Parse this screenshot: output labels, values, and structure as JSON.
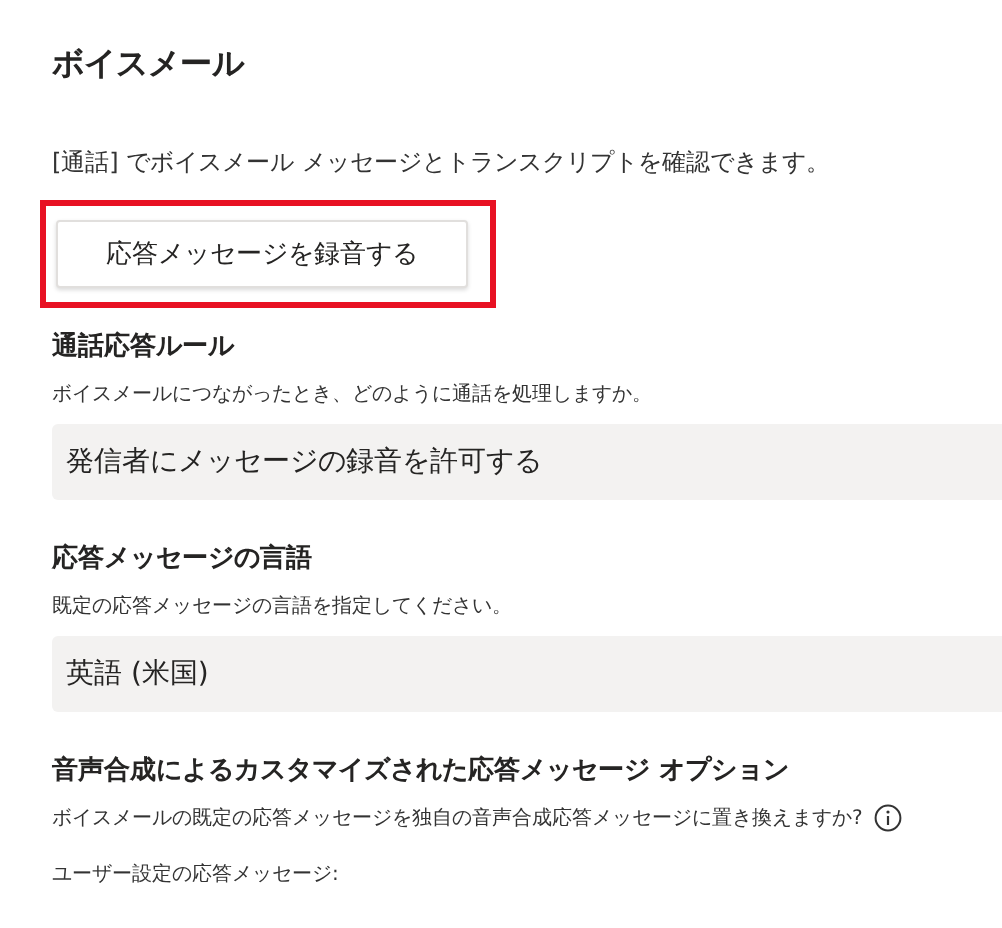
{
  "title": "ボイスメール",
  "intro": "[通話] でボイスメール メッセージとトランスクリプトを確認できます。",
  "record_button": {
    "label": "応答メッセージを録音する",
    "highlighted": true
  },
  "sections": [
    {
      "kind": "dropdown",
      "heading": "通話応答ルール",
      "description": "ボイスメールにつながったとき、どのように通話を処理しますか。",
      "value": "発信者にメッセージの録音を許可する"
    },
    {
      "kind": "dropdown",
      "heading": "応答メッセージの言語",
      "description": "既定の応答メッセージの言語を指定してください。",
      "value": "英語 (米国)"
    },
    {
      "kind": "info",
      "heading": "音声合成によるカスタマイズされた応答メッセージ オプション",
      "description": "ボイスメールの既定の応答メッセージを独自の音声合成応答メッセージに置き換えますか?",
      "label": "ユーザー設定の応答メッセージ:"
    }
  ]
}
